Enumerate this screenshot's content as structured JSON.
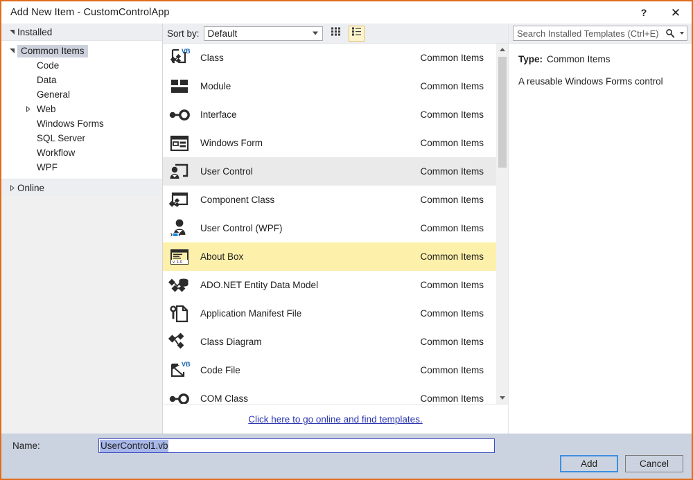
{
  "window": {
    "title": "Add New Item - CustomControlApp",
    "help_button": "?",
    "close_button": "✕"
  },
  "sidebar": {
    "installed": {
      "label": "Installed",
      "expanded": true,
      "children": [
        {
          "label": "Common Items",
          "selected": true,
          "expandable": true,
          "expanded": true,
          "level": 1
        },
        {
          "label": "Code",
          "selected": false,
          "expandable": false,
          "level": 2
        },
        {
          "label": "Data",
          "selected": false,
          "expandable": false,
          "level": 2
        },
        {
          "label": "General",
          "selected": false,
          "expandable": false,
          "level": 2
        },
        {
          "label": "Web",
          "selected": false,
          "expandable": true,
          "expanded": false,
          "level": 2
        },
        {
          "label": "Windows Forms",
          "selected": false,
          "expandable": false,
          "level": 2
        },
        {
          "label": "SQL Server",
          "selected": false,
          "expandable": false,
          "level": 2
        },
        {
          "label": "Workflow",
          "selected": false,
          "expandable": false,
          "level": 2
        },
        {
          "label": "WPF",
          "selected": false,
          "expandable": false,
          "level": 2
        }
      ]
    },
    "online": {
      "label": "Online",
      "expanded": false
    }
  },
  "toolbar": {
    "sort_by_label": "Sort by:",
    "sort_by_value": "Default",
    "view_tiles_icon": "small-icons-view-icon",
    "view_details_icon": "details-list-view-icon",
    "view_active": "details"
  },
  "search": {
    "placeholder": "Search Installed Templates (Ctrl+E)",
    "value": "",
    "icon": "search-icon"
  },
  "templates": {
    "items": [
      {
        "name": "Class",
        "category": "Common Items",
        "icon": "vb-class-icon",
        "state": "normal"
      },
      {
        "name": "Module",
        "category": "Common Items",
        "icon": "module-icon",
        "state": "normal"
      },
      {
        "name": "Interface",
        "category": "Common Items",
        "icon": "interface-icon",
        "state": "normal"
      },
      {
        "name": "Windows Form",
        "category": "Common Items",
        "icon": "windows-form-icon",
        "state": "normal"
      },
      {
        "name": "User Control",
        "category": "Common Items",
        "icon": "user-control-icon",
        "state": "hover"
      },
      {
        "name": "Component Class",
        "category": "Common Items",
        "icon": "component-class-icon",
        "state": "normal"
      },
      {
        "name": "User Control (WPF)",
        "category": "Common Items",
        "icon": "user-control-wpf-icon",
        "state": "normal"
      },
      {
        "name": "About Box",
        "category": "Common Items",
        "icon": "about-box-icon",
        "state": "selected"
      },
      {
        "name": "ADO.NET Entity Data Model",
        "category": "Common Items",
        "icon": "ado-net-entity-data-model-icon",
        "state": "normal"
      },
      {
        "name": "Application Manifest File",
        "category": "Common Items",
        "icon": "application-manifest-file-icon",
        "state": "normal"
      },
      {
        "name": "Class Diagram",
        "category": "Common Items",
        "icon": "class-diagram-icon",
        "state": "normal"
      },
      {
        "name": "Code File",
        "category": "Common Items",
        "icon": "vb-code-file-icon",
        "state": "normal"
      },
      {
        "name": "COM Class",
        "category": "Common Items",
        "icon": "com-class-icon",
        "state": "normal"
      }
    ],
    "online_link": "Click here to go online and find templates."
  },
  "details": {
    "type_label": "Type:",
    "type_value": "Common Items",
    "description": "A reusable Windows Forms control"
  },
  "footer": {
    "name_label": "Name:",
    "name_value": "UserControl1.vb",
    "add_button": "Add",
    "cancel_button": "Cancel"
  },
  "colors": {
    "dialog_border": "#e06c19",
    "selected_row": "#fdf0ab",
    "hover_row": "#eaeaea",
    "tree_selection": "#cdd1dc",
    "footer_bg": "#ccd3e0",
    "link": "#2a34b0",
    "text_selection": "#a8b7e8",
    "accent_button": "#3c8fe0"
  }
}
